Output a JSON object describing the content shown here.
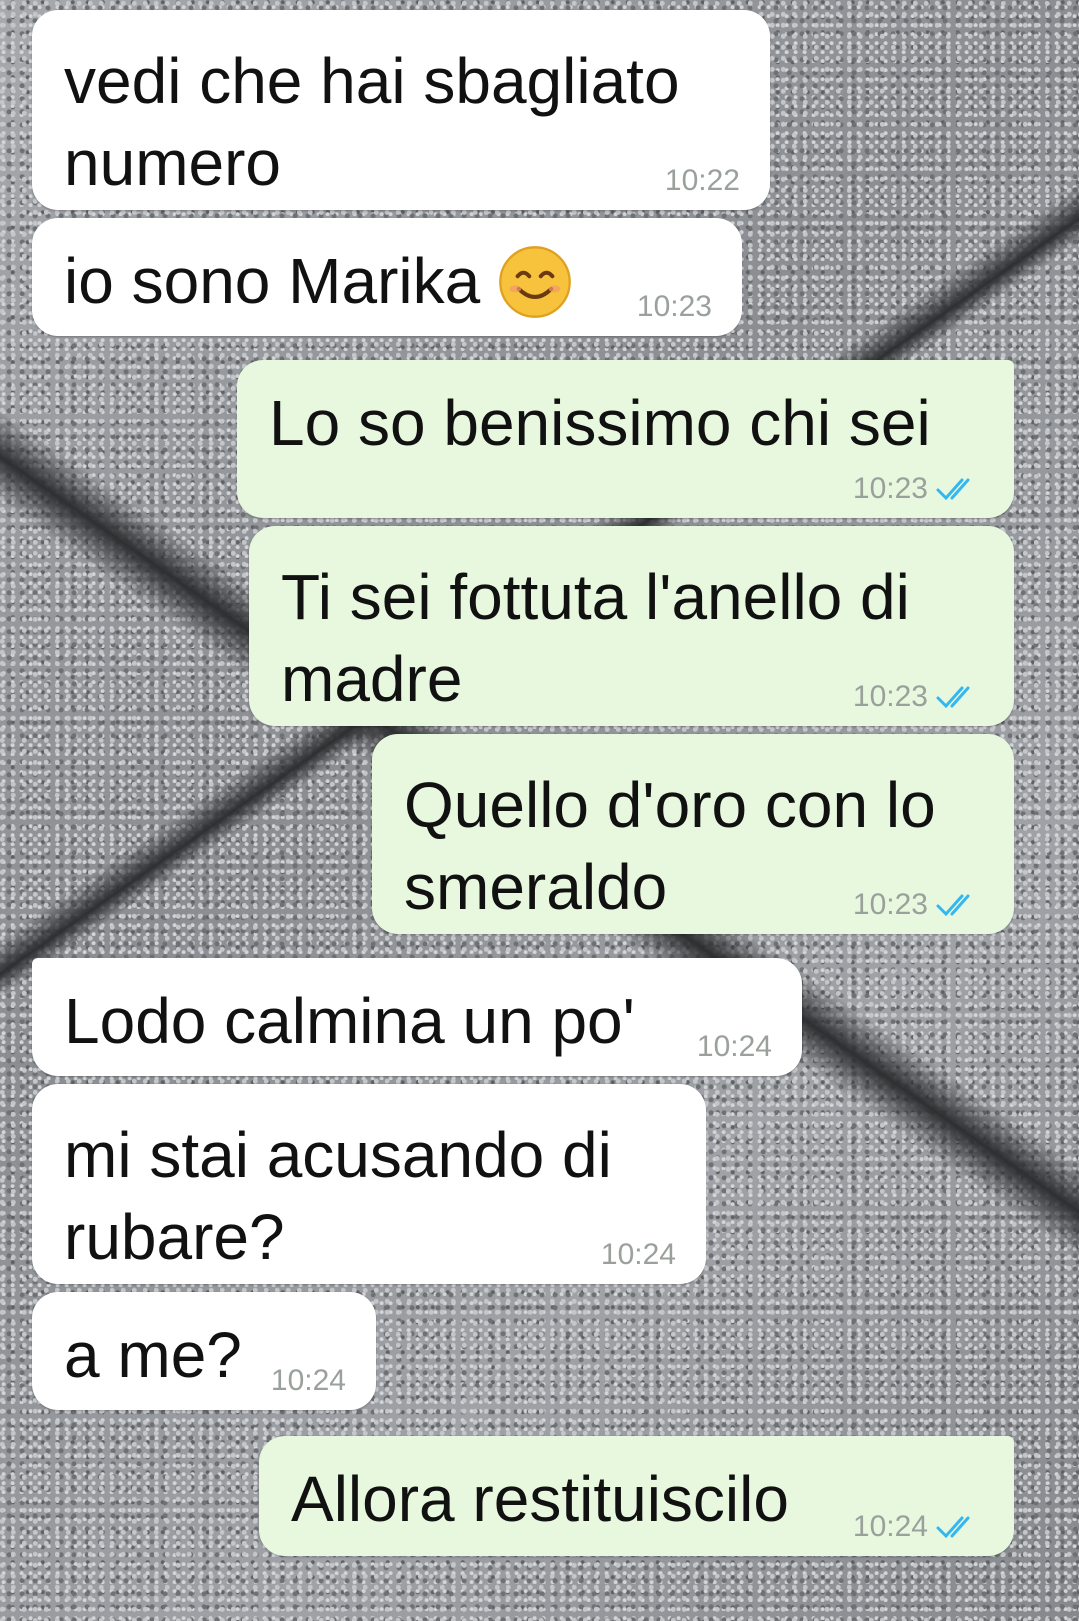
{
  "messages": [
    {
      "direction": "in",
      "text": "vedi che hai sbagliato\nnumero",
      "time": "10:22"
    },
    {
      "direction": "in",
      "text": "io sono Marika",
      "emoji": "smiling-face-icon",
      "time": "10:23"
    },
    {
      "direction": "out",
      "text": "Lo so benissimo chi sei",
      "time": "10:23",
      "status": "double-check-icon"
    },
    {
      "direction": "out",
      "text": "Ti sei fottuta l'anello di\nmadre",
      "time": "10:23",
      "status": "double-check-icon"
    },
    {
      "direction": "out",
      "text": "Quello d'oro con lo\nsmeraldo",
      "time": "10:23",
      "status": "double-check-icon"
    },
    {
      "direction": "in",
      "text": "Lodo calmina un po'",
      "time": "10:24"
    },
    {
      "direction": "in",
      "text": "mi stai acusando di\nrubare?",
      "time": "10:24"
    },
    {
      "direction": "in",
      "text": "a me?",
      "time": "10:24"
    },
    {
      "direction": "out",
      "text": "Allora restituiscilo",
      "time": "10:24",
      "status": "double-check-icon"
    }
  ],
  "colors": {
    "incoming_bubble": "#ffffff",
    "outgoing_bubble": "#e7f8df",
    "timestamp": "#9aa09b",
    "read_ticks": "#34b7f1"
  }
}
